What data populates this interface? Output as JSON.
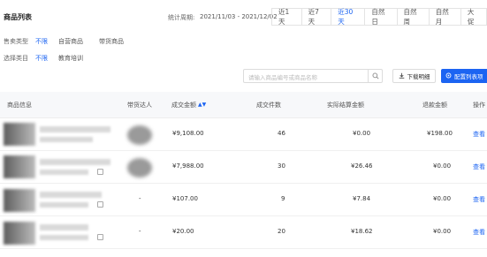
{
  "header": {
    "title": "商品列表",
    "stat_label": "统计周期:",
    "stat_range": "2021/11/03 - 2021/12/02",
    "tabs": [
      {
        "label": "近1天",
        "active": false
      },
      {
        "label": "近7天",
        "active": false
      },
      {
        "label": "近30天",
        "active": true
      },
      {
        "label": "自然日",
        "active": false
      },
      {
        "label": "自然周",
        "active": false
      },
      {
        "label": "自然月",
        "active": false
      },
      {
        "label": "大促",
        "active": false
      }
    ]
  },
  "filters": {
    "sale_type": {
      "label": "售卖类型",
      "options": [
        "不限",
        "自营商品",
        "带货商品"
      ],
      "active": 0
    },
    "category": {
      "label": "选择类目",
      "options": [
        "不限",
        "教育培训"
      ],
      "active": 0
    }
  },
  "search": {
    "placeholder": "请输入商品编号或商品名称"
  },
  "toolbar": {
    "download_label": "下载明细",
    "config_label": "配置列表项"
  },
  "colors": {
    "accent": "#1c64f2"
  },
  "table": {
    "columns": [
      "商品信息",
      "带货达人",
      "成交金额",
      "成交件数",
      "实际结算金额",
      "退款金额",
      "操作"
    ],
    "rows": [
      {
        "talent": "",
        "amount": "¥9,108.00",
        "count": "46",
        "settle": "¥0.00",
        "refund": "¥198.00",
        "action": "查看"
      },
      {
        "talent": "",
        "amount": "¥7,988.00",
        "count": "30",
        "settle": "¥26.46",
        "refund": "¥0.00",
        "action": "查看"
      },
      {
        "talent": "-",
        "amount": "¥107.00",
        "count": "9",
        "settle": "¥7.84",
        "refund": "¥0.00",
        "action": "查看"
      },
      {
        "talent": "-",
        "amount": "¥20.00",
        "count": "20",
        "settle": "¥18.62",
        "refund": "¥0.00",
        "action": "查看"
      }
    ]
  }
}
